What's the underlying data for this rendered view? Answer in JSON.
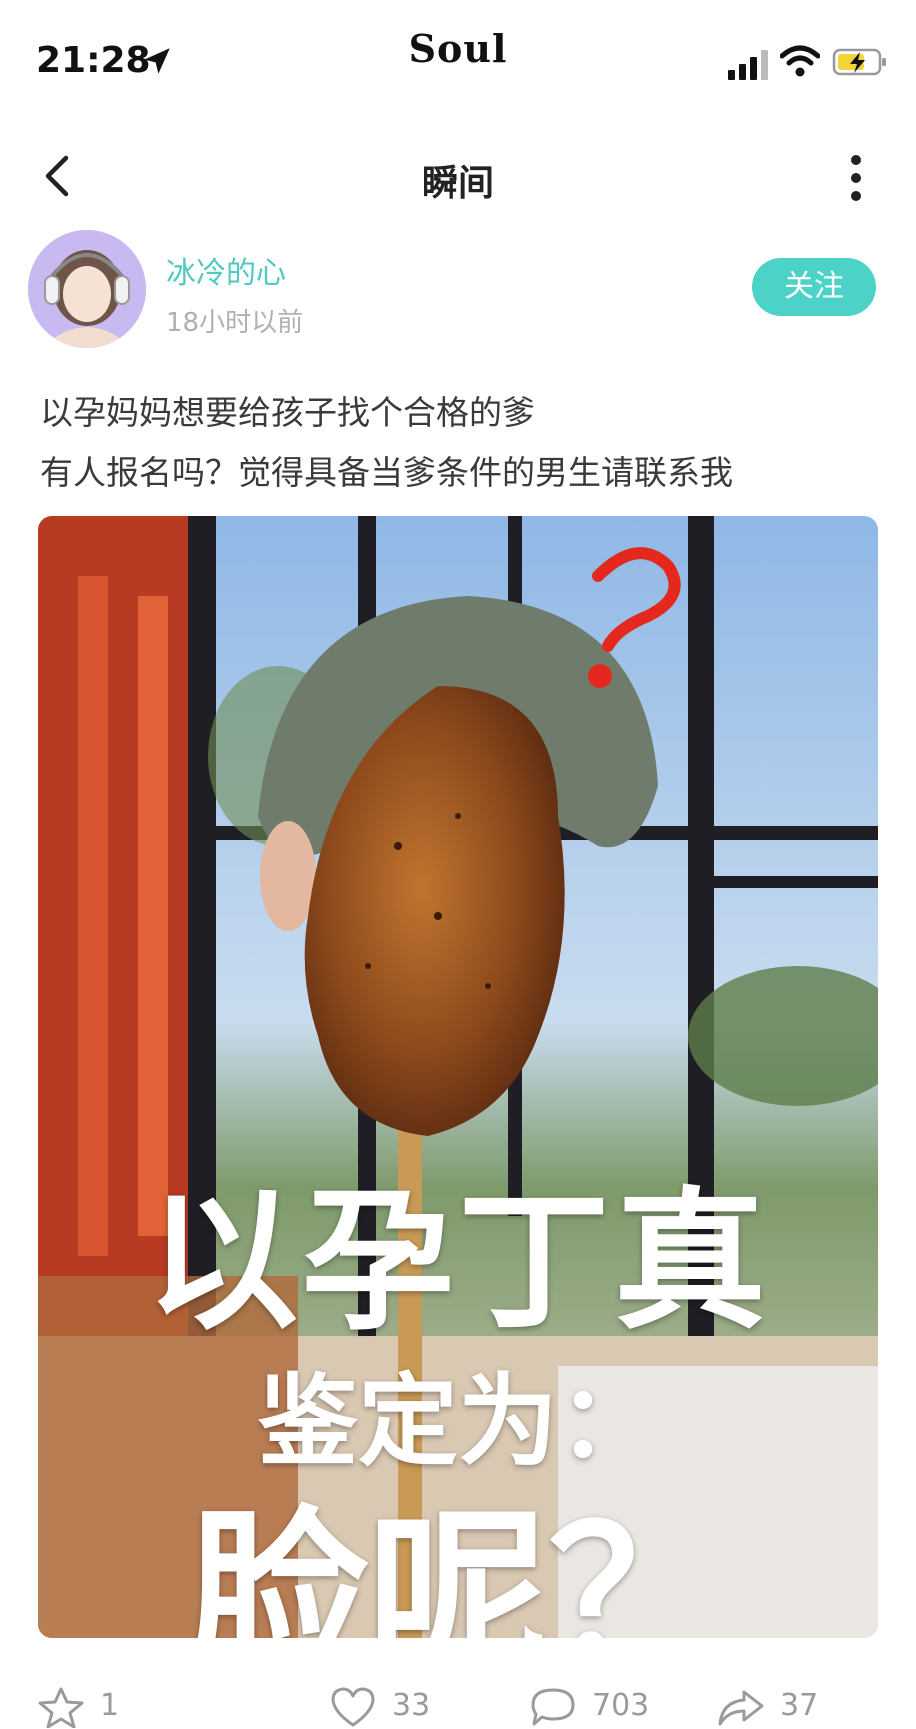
{
  "status_bar": {
    "time": "21:28",
    "brand": "Soul"
  },
  "navbar": {
    "title": "瞬间"
  },
  "author": {
    "name": "冰冷的心",
    "time_ago": "18小时以前",
    "follow_label": "关注"
  },
  "post": {
    "line1": "以孕妈妈想要给孩子找个合格的爹",
    "line2": "有人报名吗？觉得具备当爹条件的男生请联系我"
  },
  "image_overlay": {
    "line1": "以孕丁真",
    "line2": "鉴定为：",
    "line3": "脸呢？"
  },
  "actions": {
    "star_count": "1",
    "like_count": "33",
    "comment_count": "703",
    "share_count": "37"
  },
  "colors": {
    "accent": "#4cd2c6",
    "name": "#4fc9c1"
  }
}
